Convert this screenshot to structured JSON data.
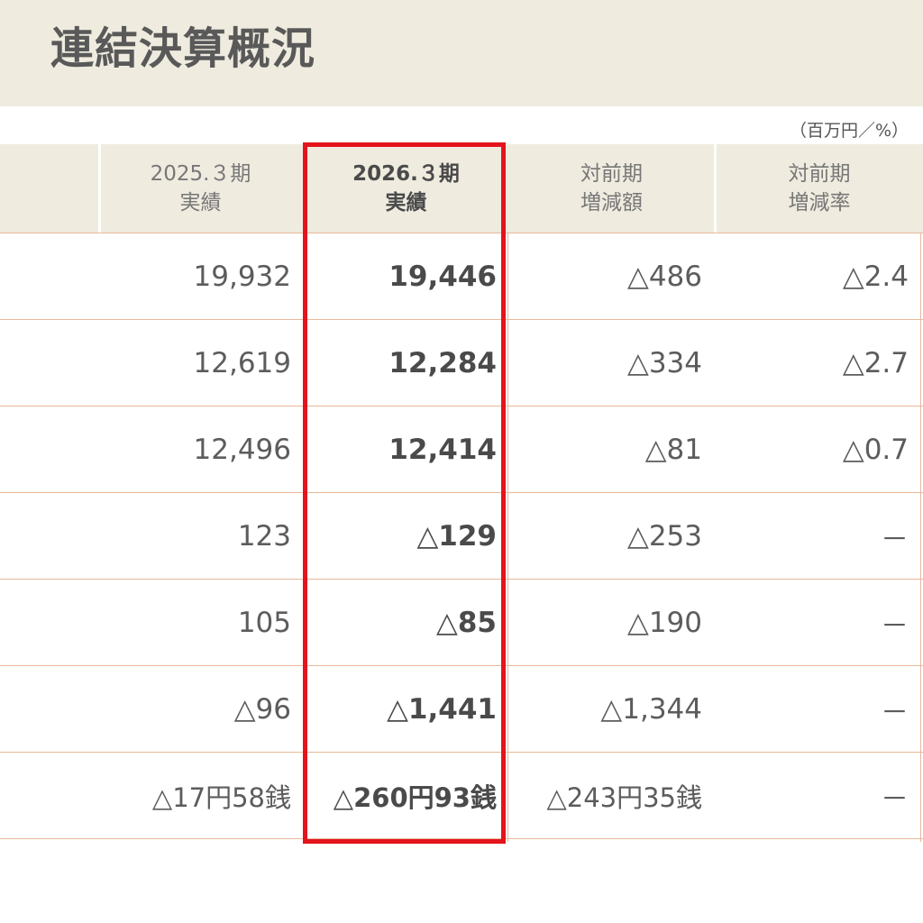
{
  "title": "連結決算概況",
  "unit": "（百万円／%）",
  "headers": [
    {
      "line1": "2025.３期",
      "line2": "実績"
    },
    {
      "line1": "2026.３期",
      "line2": "実績"
    },
    {
      "line1": "対前期",
      "line2": "増減額"
    },
    {
      "line1": "対前期",
      "line2": "増減率"
    }
  ],
  "rows": [
    [
      "19,932",
      "19,446",
      "△486",
      "△2.4"
    ],
    [
      "12,619",
      "12,284",
      "△334",
      "△2.7"
    ],
    [
      "12,496",
      "12,414",
      "△81",
      "△0.7"
    ],
    [
      "123",
      "△129",
      "△253",
      "－"
    ],
    [
      "105",
      "△85",
      "△190",
      "－"
    ],
    [
      "△96",
      "△1,441",
      "△1,344",
      "－"
    ],
    [
      "△17円58銭",
      "△260円93銭",
      "△243円35銭",
      "－"
    ]
  ],
  "colors": {
    "header_bg": "#efebdf",
    "row_line": "#e8b89a",
    "highlight": "#e3141b",
    "text": "#5c5c5c"
  }
}
